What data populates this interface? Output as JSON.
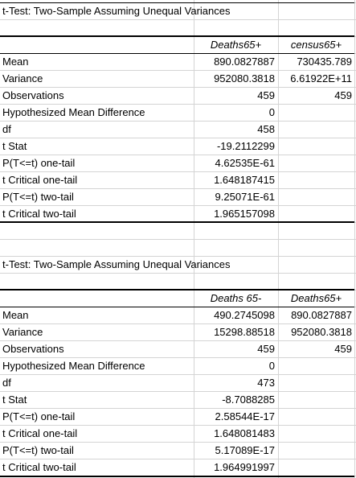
{
  "tables": [
    {
      "title": "t-Test: Two-Sample Assuming Unequal Variances",
      "col_headers": [
        "Deaths65+",
        "census65+"
      ],
      "rows": [
        {
          "label": "Mean",
          "v1": "890.0827887",
          "v2": "730435.789"
        },
        {
          "label": "Variance",
          "v1": "952080.3818",
          "v2": "6.61922E+11"
        },
        {
          "label": "Observations",
          "v1": "459",
          "v2": "459"
        },
        {
          "label": "Hypothesized Mean Difference",
          "v1": "0",
          "v2": ""
        },
        {
          "label": "df",
          "v1": "458",
          "v2": ""
        },
        {
          "label": "t Stat",
          "v1": "-19.2112299",
          "v2": ""
        },
        {
          "label": "P(T<=t) one-tail",
          "v1": "4.62535E-61",
          "v2": ""
        },
        {
          "label": "t Critical one-tail",
          "v1": "1.648187415",
          "v2": ""
        },
        {
          "label": "P(T<=t) two-tail",
          "v1": "9.25071E-61",
          "v2": ""
        },
        {
          "label": "t Critical two-tail",
          "v1": "1.965157098",
          "v2": ""
        }
      ]
    },
    {
      "title": "t-Test: Two-Sample Assuming Unequal Variances",
      "col_headers": [
        "Deaths 65-",
        "Deaths65+"
      ],
      "rows": [
        {
          "label": "Mean",
          "v1": "490.2745098",
          "v2": "890.0827887"
        },
        {
          "label": "Variance",
          "v1": "15298.88518",
          "v2": "952080.3818"
        },
        {
          "label": "Observations",
          "v1": "459",
          "v2": "459"
        },
        {
          "label": "Hypothesized Mean Difference",
          "v1": "0",
          "v2": ""
        },
        {
          "label": "df",
          "v1": "473",
          "v2": ""
        },
        {
          "label": "t Stat",
          "v1": "-8.7088285",
          "v2": ""
        },
        {
          "label": "P(T<=t) one-tail",
          "v1": "2.58544E-17",
          "v2": ""
        },
        {
          "label": "t Critical one-tail",
          "v1": "1.648081483",
          "v2": ""
        },
        {
          "label": "P(T<=t) two-tail",
          "v1": "5.17089E-17",
          "v2": ""
        },
        {
          "label": "t Critical two-tail",
          "v1": "1.964991997",
          "v2": ""
        }
      ]
    }
  ]
}
